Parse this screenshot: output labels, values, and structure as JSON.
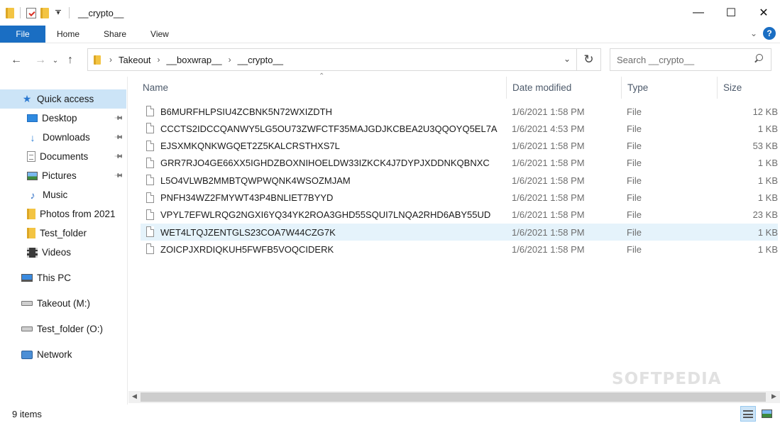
{
  "window": {
    "title": "__crypto__",
    "minimize_glyph": "—",
    "maximize_glyph": "☐",
    "close_glyph": "✕"
  },
  "ribbon": {
    "tabs": [
      "File",
      "Home",
      "Share",
      "View"
    ],
    "help_label": "?"
  },
  "navigation": {
    "breadcrumb": [
      "Takeout",
      "__boxwrap__",
      "__crypto__"
    ],
    "search_placeholder": "Search __crypto__"
  },
  "sidebar": {
    "quick_access": "Quick access",
    "pinned": [
      {
        "label": "Desktop",
        "icon": "desktop-icon",
        "pinned": true
      },
      {
        "label": "Downloads",
        "icon": "downloads-icon",
        "pinned": true
      },
      {
        "label": "Documents",
        "icon": "documents-icon",
        "pinned": true
      },
      {
        "label": "Pictures",
        "icon": "pictures-icon",
        "pinned": true
      },
      {
        "label": "Music",
        "icon": "music-icon",
        "pinned": false
      },
      {
        "label": "Photos from 2021",
        "icon": "folder-icon",
        "pinned": false
      },
      {
        "label": "Test_folder",
        "icon": "folder-icon",
        "pinned": false
      },
      {
        "label": "Videos",
        "icon": "videos-icon",
        "pinned": false
      }
    ],
    "locations": [
      {
        "label": "This PC",
        "icon": "this-pc-icon"
      },
      {
        "label": "Takeout (M:)",
        "icon": "drive-icon"
      },
      {
        "label": "Test_folder (O:)",
        "icon": "drive-icon"
      },
      {
        "label": "Network",
        "icon": "network-icon"
      }
    ]
  },
  "file_list": {
    "columns": {
      "name": "Name",
      "date": "Date modified",
      "type": "Type",
      "size": "Size"
    },
    "sort_column": "Name",
    "selected_index": 7,
    "rows": [
      {
        "name": "B6MURFHLPSIU4ZCBNK5N72WXIZDTH",
        "date": "1/6/2021 1:58 PM",
        "type": "File",
        "size": "12 KB"
      },
      {
        "name": "CCCTS2IDCCQANWY5LG5OU73ZWFCTF35MAJGDJKCBEA2U3QQOYQ5EL7A",
        "date": "1/6/2021 4:53 PM",
        "type": "File",
        "size": "1 KB"
      },
      {
        "name": "EJSXMKQNKWGQET2Z5KALCRSTHXS7L",
        "date": "1/6/2021 1:58 PM",
        "type": "File",
        "size": "53 KB"
      },
      {
        "name": "GRR7RJO4GE66XX5IGHDZBOXNIHOELDW33IZKCK4J7DYPJXDDNKQBNXC",
        "date": "1/6/2021 1:58 PM",
        "type": "File",
        "size": "1 KB"
      },
      {
        "name": "L5O4VLWB2MMBTQWPWQNK4WSOZMJAM",
        "date": "1/6/2021 1:58 PM",
        "type": "File",
        "size": "1 KB"
      },
      {
        "name": "PNFH34WZ2FMYWT43P4BNLIET7BYYD",
        "date": "1/6/2021 1:58 PM",
        "type": "File",
        "size": "1 KB"
      },
      {
        "name": "VPYL7EFWLRQG2NGXI6YQ34YK2ROA3GHD55SQUI7LNQA2RHD6ABY55UD",
        "date": "1/6/2021 1:58 PM",
        "type": "File",
        "size": "23 KB"
      },
      {
        "name": "WET4LTQJZENTGLS23COA7W44CZG7K",
        "date": "1/6/2021 1:58 PM",
        "type": "File",
        "size": "1 KB"
      },
      {
        "name": "ZOICPJXRDIQKUH5FWFB5VOQCIDERK",
        "date": "1/6/2021 1:58 PM",
        "type": "File",
        "size": "1 KB"
      }
    ]
  },
  "status": {
    "item_count": "9 items",
    "view": "details"
  },
  "watermark": "SOFTPEDIA",
  "colors": {
    "accent": "#1a6ec3",
    "selection": "#cce4f7",
    "hover_row": "#e5f3fb"
  }
}
